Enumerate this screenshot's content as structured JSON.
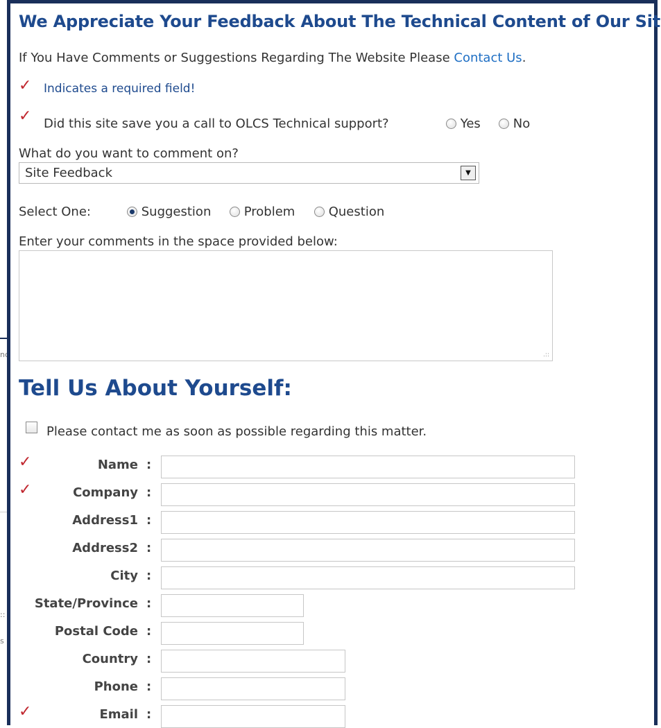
{
  "title": "We Appreciate Your Feedback About The Technical Content of Our Site.",
  "intro": {
    "text": "If You Have Comments or Suggestions Regarding The Website Please ",
    "link": "Contact Us",
    "suffix": "."
  },
  "required_note": "Indicates a required field!",
  "call_question": {
    "text": "Did this site save you a call to OLCS Technical support?",
    "options": [
      "Yes",
      "No"
    ]
  },
  "comment_on": {
    "label": "What do you want to comment on?",
    "selected": "Site Feedback"
  },
  "select_one": {
    "label": "Select One:",
    "options": [
      "Suggestion",
      "Problem",
      "Question"
    ],
    "selected": "Suggestion"
  },
  "comments_label": "Enter your comments in the space provided below:",
  "about_heading": "Tell Us About Yourself:",
  "contact_checkbox_label": "Please contact me as soon as possible regarding this matter.",
  "colon": ":",
  "fields": [
    {
      "label": "Name",
      "required": true
    },
    {
      "label": "Company",
      "required": true
    },
    {
      "label": "Address1",
      "required": false
    },
    {
      "label": "Address2",
      "required": false
    },
    {
      "label": "City",
      "required": false
    },
    {
      "label": "State/Province",
      "required": false
    },
    {
      "label": "Postal Code",
      "required": false
    },
    {
      "label": "Country",
      "required": false
    },
    {
      "label": "Phone",
      "required": false
    },
    {
      "label": "Email",
      "required": true
    }
  ],
  "colors": {
    "heading": "#1e4a8e",
    "link": "#1f6fc4",
    "required_check": "#c0262e",
    "frame": "#1a2f5a"
  },
  "icons": {
    "required": "checkmark-icon",
    "dropdown": "dropdown-arrow-icon",
    "resize": "resize-grip-icon"
  }
}
